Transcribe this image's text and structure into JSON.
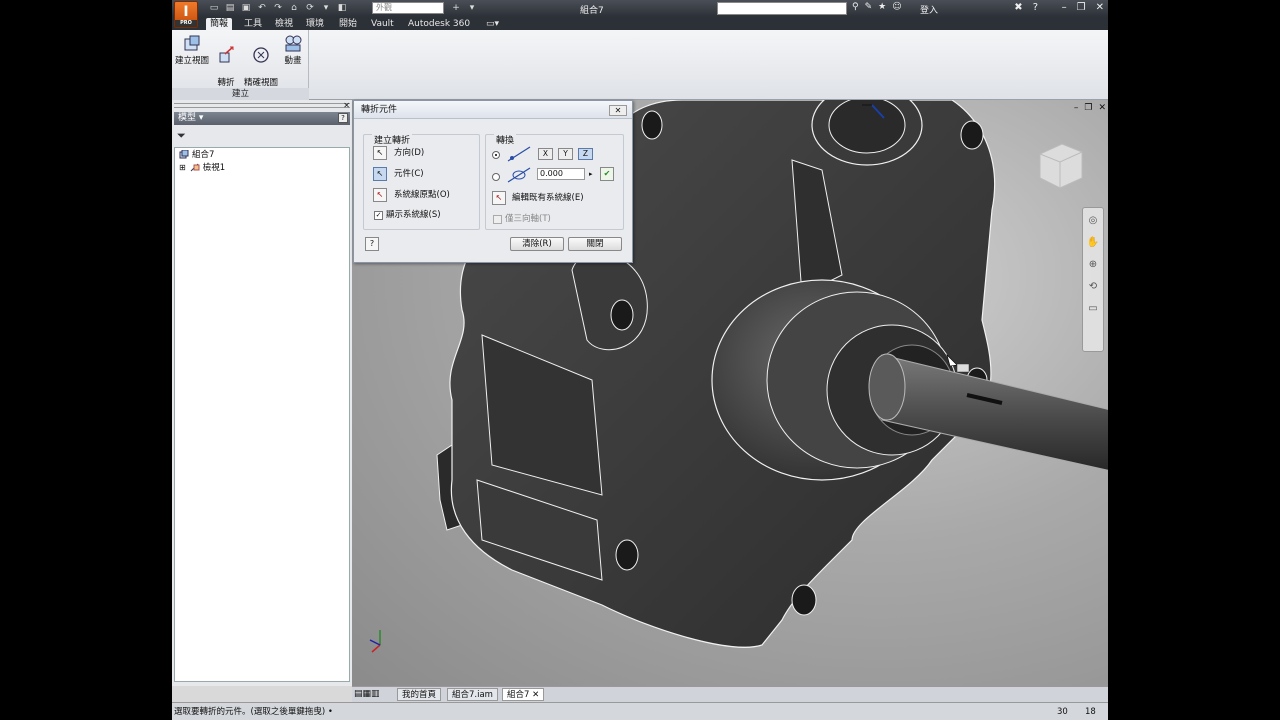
{
  "titlebar": {
    "window_title": "組合7",
    "style_placeholder": "外觀",
    "signin": "登入",
    "logo_text": "I",
    "logo_sub": "PRO"
  },
  "ribbon_tabs": [
    "簡報",
    "工具",
    "檢視",
    "環境",
    "開始",
    "Vault",
    "Autodesk 360"
  ],
  "active_tab": "簡報",
  "ribbon": {
    "buttons": [
      {
        "label": "建立視圖"
      },
      {
        "label": "轉折\n元件"
      },
      {
        "label": "精確視圖\n旋轉"
      },
      {
        "label": "動畫"
      }
    ],
    "group_label": "建立"
  },
  "browser": {
    "title": "模型 ▾",
    "help": "?",
    "tree": [
      {
        "label": "組合7",
        "level": 0
      },
      {
        "label": "檢視1",
        "level": 1
      }
    ]
  },
  "dialog": {
    "title": "轉折元件",
    "close": "✕",
    "create_group": {
      "legend": "建立轉折",
      "direction": "方向(D)",
      "component": "元件(C)",
      "origin": "系統線原點(O)",
      "show_trails": "顯示系統線(S)"
    },
    "transform_group": {
      "legend": "轉換",
      "axes": [
        "X",
        "Y",
        "Z"
      ],
      "active_axis": "Z",
      "angle_value": "0.000",
      "edit_trails": "編輯既有系統線(E)",
      "triad_only": "僅三向軸(T)"
    },
    "help": "?",
    "clear": "清除(R)",
    "close_btn": "關閉"
  },
  "doc_tabs": [
    {
      "label": "我的首頁"
    },
    {
      "label": "組合7.iam"
    },
    {
      "label": "組合7 ✕",
      "active": true
    }
  ],
  "status": {
    "text": "選取要轉折的元件。(選取之後單鍵拖曳) •",
    "n1": "30",
    "n2": "18"
  },
  "colors": {
    "accent": "#e8681c",
    "model": "#3a3a3a",
    "edge": "#f0f0f0"
  }
}
